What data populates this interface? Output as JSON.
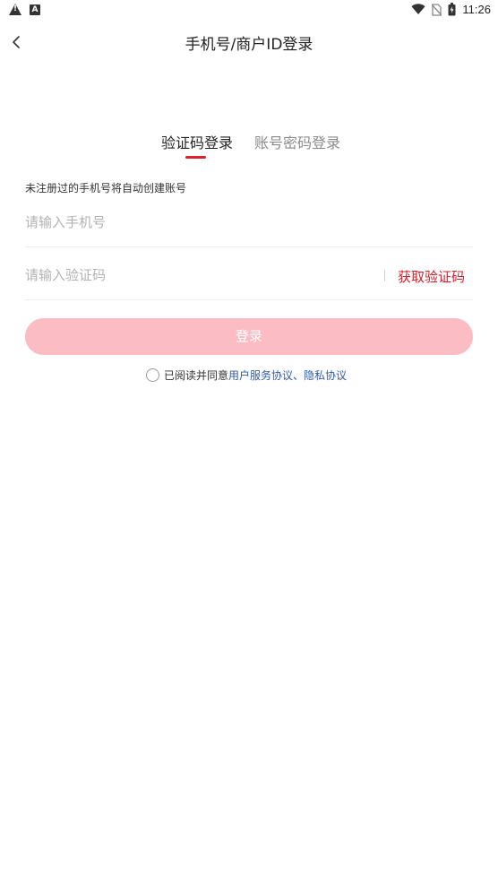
{
  "status_bar": {
    "time": "11:26",
    "icons": [
      "warning-icon",
      "a-notification-icon",
      "wifi-icon",
      "no-sim-icon",
      "battery-icon"
    ]
  },
  "header": {
    "title": "手机号/商户ID登录",
    "back_icon": "chevron-left-icon"
  },
  "tabs": [
    {
      "label": "验证码登录",
      "active": true
    },
    {
      "label": "账号密码登录",
      "active": false
    }
  ],
  "form": {
    "hint": "未注册过的手机号将自动创建账号",
    "phone_placeholder": "请输入手机号",
    "phone_value": "",
    "code_placeholder": "请输入验证码",
    "code_value": "",
    "get_code_label": "获取验证码",
    "login_label": "登录"
  },
  "agreement": {
    "prefix": "已阅读并同意",
    "user_agreement": "用户服务协议",
    "separator": "、",
    "privacy_policy": "隐私协议",
    "checked": false
  },
  "colors": {
    "accent_red": "#d41d2b",
    "tab_underline": "#e0202e",
    "login_button_disabled": "#fbbcc3",
    "link_blue": "#2f5aa8"
  }
}
